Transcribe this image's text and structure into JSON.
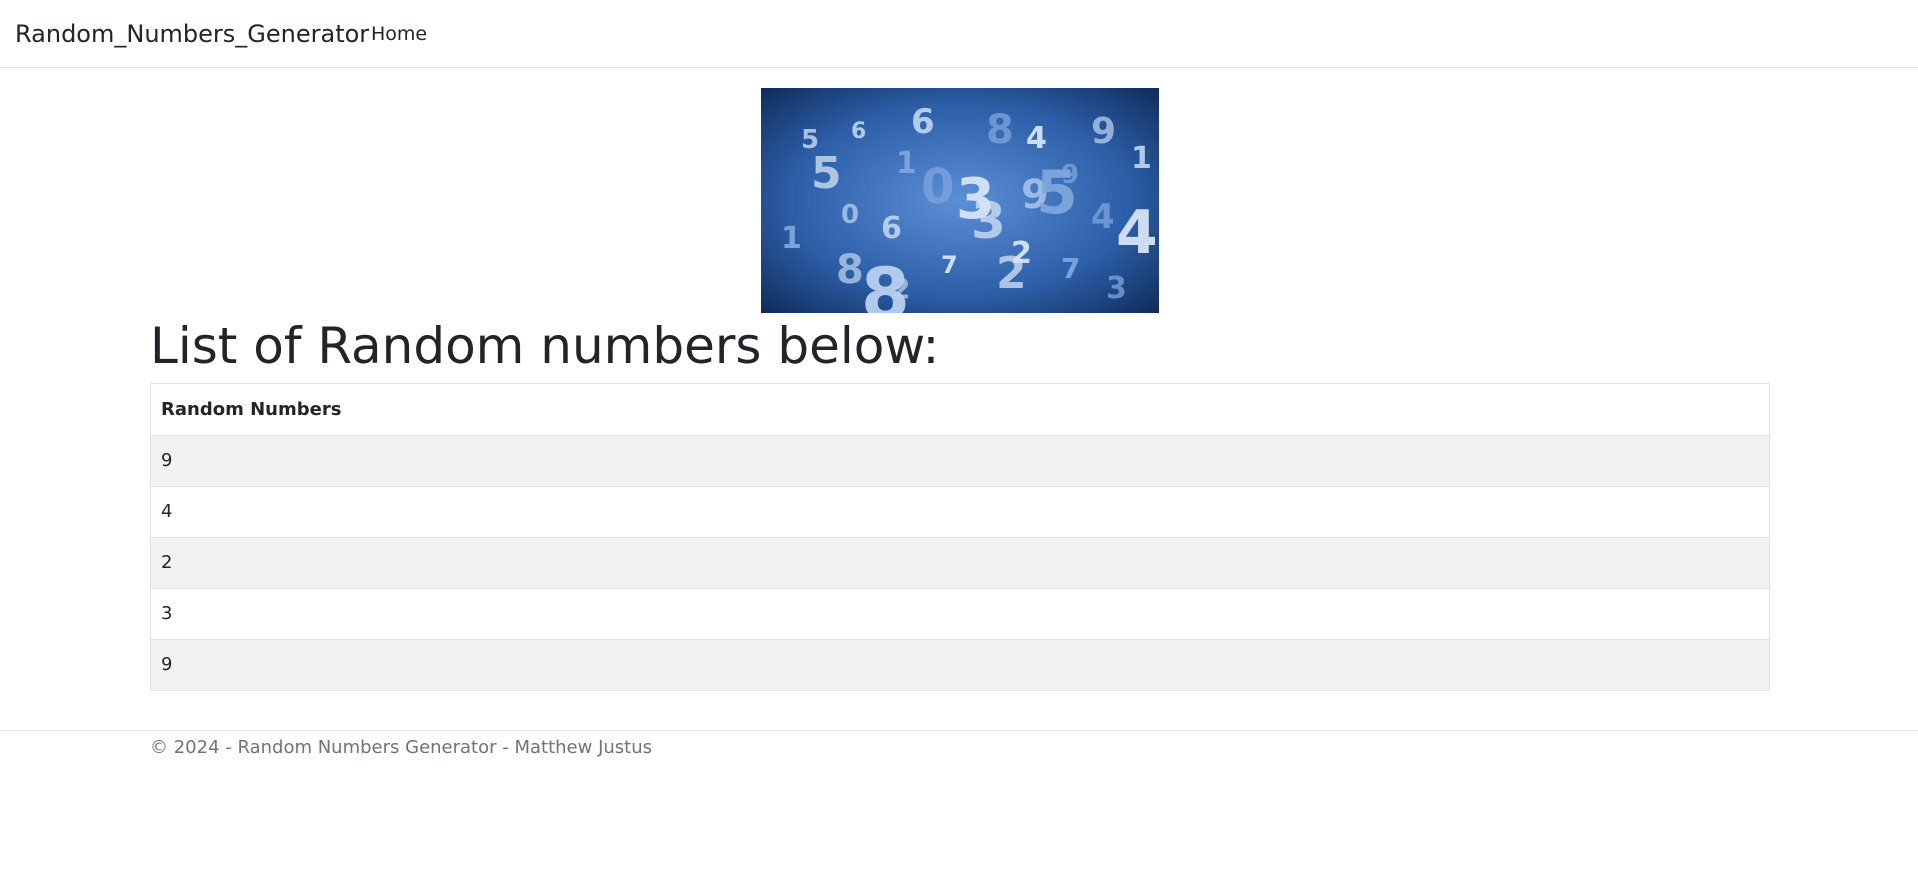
{
  "navbar": {
    "brand": "Random_Numbers_Generator",
    "links": [
      {
        "label": "Home"
      }
    ]
  },
  "hero_image": {
    "digits": [
      "6",
      "8",
      "4",
      "9",
      "1",
      "5",
      "1",
      "0",
      "3",
      "9",
      "5",
      "3",
      "6",
      "4",
      "2",
      "8",
      "7",
      "2",
      "8",
      "3",
      "4",
      "0",
      "1",
      "5",
      "6",
      "9",
      "7",
      "2"
    ]
  },
  "main": {
    "title": "List of Random numbers below:",
    "table": {
      "header": "Random Numbers",
      "rows": [
        "9",
        "4",
        "2",
        "3",
        "9"
      ]
    }
  },
  "footer": {
    "text": "© 2024 - Random Numbers Generator - Matthew Justus"
  },
  "colors": {
    "text": "#212529",
    "muted": "#6c757d",
    "border": "#dee2e6",
    "stripe": "#f2f2f2",
    "image_blue": "#1f4a8c"
  }
}
